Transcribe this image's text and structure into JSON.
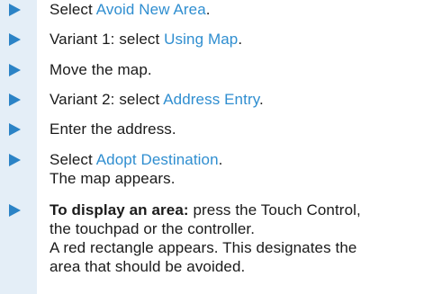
{
  "colors": {
    "arrow": "#2b83c6",
    "link": "#2f8ed0",
    "band": "#e4eef7",
    "text": "#1a1a1a"
  },
  "icons": {
    "step_marker": "triangle-right-icon"
  },
  "steps": [
    {
      "prefix": "Select ",
      "link": "Avoid New Area",
      "suffix": "."
    },
    {
      "prefix": "Variant 1: select ",
      "link": "Using Map",
      "suffix": "."
    },
    {
      "text": "Move the map."
    },
    {
      "prefix": "Variant 2: select ",
      "link": "Address Entry",
      "suffix": "."
    },
    {
      "text": "Enter the address."
    },
    {
      "prefix": "Select ",
      "link": "Adopt Destination",
      "suffix": ".",
      "result": "The map appears."
    },
    {
      "bold": "To display an area:",
      "rest": " press the Touch Control,",
      "lines": [
        "the touchpad or the controller.",
        "A red rectangle appears. This designates the",
        "area that should be avoided."
      ]
    }
  ]
}
